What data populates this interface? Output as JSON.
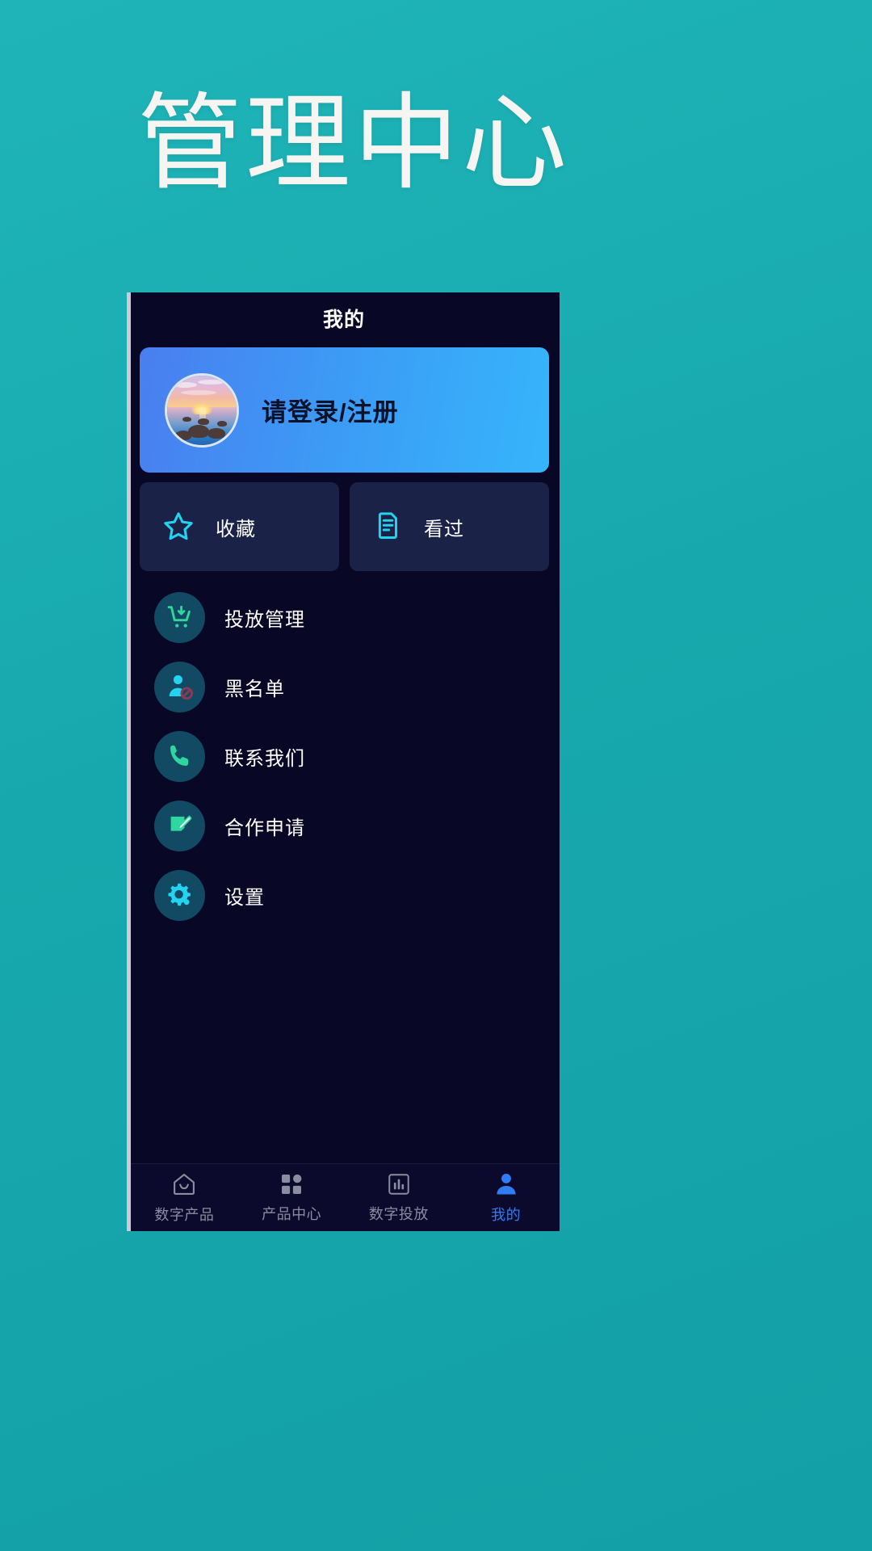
{
  "page": {
    "title": "管理中心",
    "bg_color": "#17a8ad",
    "title_color": "#f7f5f2"
  },
  "app": {
    "header_title": "我的",
    "bg_color": "#080726",
    "accent_cyan": "#23d3ef",
    "accent_blue": "#2f7cf6",
    "card_bg": "#1b2247",
    "icon_circle_bg": "#124a63"
  },
  "login": {
    "label": "请登录/注册",
    "avatar_icon": "sunset-beach-photo-avatar",
    "gradient_from": "#4a7ef0",
    "gradient_to": "#36b5fb",
    "text_color": "#08122b"
  },
  "quick_cards": [
    {
      "label": "收藏",
      "icon": "star-icon",
      "name": "favorites"
    },
    {
      "label": "看过",
      "icon": "document-stack-icon",
      "name": "viewed"
    }
  ],
  "menu": [
    {
      "label": "投放管理",
      "icon": "cart-download-icon",
      "icon_color": "#2fd6a0",
      "name": "delivery-management"
    },
    {
      "label": "黑名单",
      "icon": "user-blocked-icon",
      "icon_color": "#23d3ef",
      "name": "blacklist"
    },
    {
      "label": "联系我们",
      "icon": "phone-icon",
      "icon_color": "#2fd6a0",
      "name": "contact-us"
    },
    {
      "label": "合作申请",
      "icon": "edit-note-icon",
      "icon_color": "#2fd6a0",
      "name": "partnership-application"
    },
    {
      "label": "设置",
      "icon": "gear-icon",
      "icon_color": "#23d3ef",
      "name": "settings"
    }
  ],
  "tabs": [
    {
      "label": "数字产品",
      "icon": "home-icon",
      "active": false,
      "name": "digital-products"
    },
    {
      "label": "产品中心",
      "icon": "grid-icon",
      "active": false,
      "name": "product-center"
    },
    {
      "label": "数字投放",
      "icon": "bar-chart-icon",
      "active": false,
      "name": "digital-delivery"
    },
    {
      "label": "我的",
      "icon": "person-icon",
      "active": true,
      "name": "mine"
    }
  ]
}
